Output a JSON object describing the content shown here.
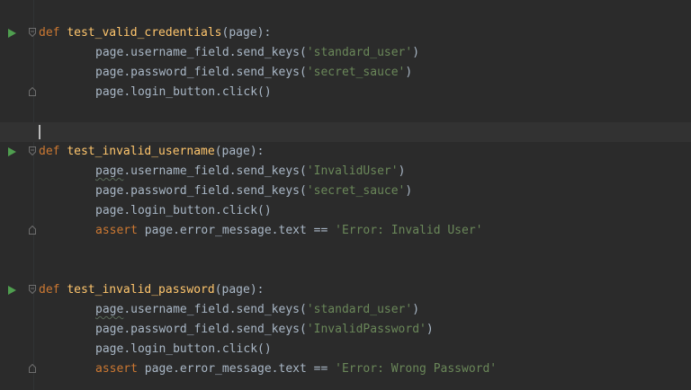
{
  "editor": {
    "colors": {
      "background": "#2b2b2b",
      "keyword": "#cc7832",
      "function": "#ffc66d",
      "string": "#6a8759",
      "text": "#a9b7c6",
      "run_icon": "#4f9e4f"
    },
    "icons": [
      "run-test-icon",
      "fold-icon"
    ],
    "blocks": [
      {
        "def_kw": "def",
        "func_name": "test_valid_credentials",
        "params": "(page):",
        "lines": [
          {
            "obj": "page",
            "rest": ".username_field.send_keys(",
            "arg": "'standard_user'",
            "close": ")"
          },
          {
            "obj": "page",
            "rest": ".password_field.send_keys(",
            "arg": "'secret_sauce'",
            "close": ")"
          },
          {
            "obj": "page",
            "rest": ".login_button.click()"
          }
        ]
      },
      {
        "def_kw": "def",
        "func_name": "test_invalid_username",
        "params": "(page):",
        "lines": [
          {
            "obj": "page",
            "rest": ".username_field.send_keys(",
            "arg": "'InvalidUser'",
            "close": ")"
          },
          {
            "obj": "page",
            "rest": ".password_field.send_keys(",
            "arg": "'secret_sauce'",
            "close": ")"
          },
          {
            "obj": "page",
            "rest": ".login_button.click()"
          },
          {
            "assert_kw": "assert",
            "expr": " page.error_message.text == ",
            "arg": "'Error: Invalid User'"
          }
        ]
      },
      {
        "def_kw": "def",
        "func_name": "test_invalid_password",
        "params": "(page):",
        "lines": [
          {
            "obj": "page",
            "rest": ".username_field.send_keys(",
            "arg": "'standard_user'",
            "close": ")"
          },
          {
            "obj": "page",
            "rest": ".password_field.send_keys(",
            "arg": "'InvalidPassword'",
            "close": ")"
          },
          {
            "obj": "page",
            "rest": ".login_button.click()"
          },
          {
            "assert_kw": "assert",
            "expr": " page.error_message.text == ",
            "arg": "'Error: Wrong Password'"
          }
        ]
      }
    ]
  }
}
